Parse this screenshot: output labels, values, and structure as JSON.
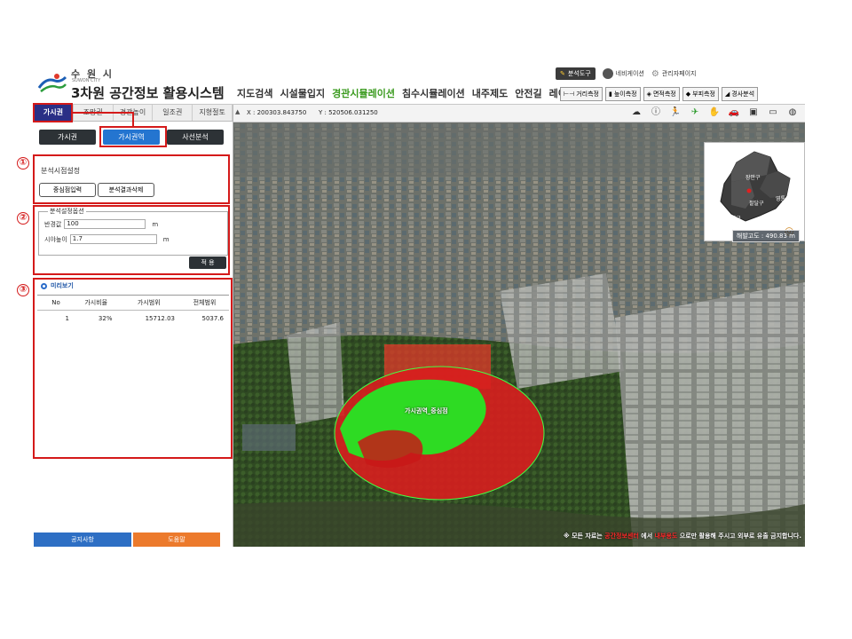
{
  "header": {
    "city_name": "수 원 시",
    "city_name_en": "SUWON CITY",
    "system_title": "3차원 공간정보 활용시스템",
    "nav": [
      "지도검색",
      "시설물입지",
      "경관시뮬레이션",
      "침수시뮬레이션",
      "내주제도",
      "안전길",
      "레이어"
    ],
    "active_nav": "경관시뮬레이션",
    "tools_top": [
      "분석도구",
      "네비게이션",
      "관리자페이지"
    ],
    "tools_measure": [
      "거리측정",
      "높이측정",
      "면적측정",
      "부피측정",
      "경사분석"
    ]
  },
  "left_panel": {
    "tabs": [
      "가시권",
      "조망권",
      "경관높이",
      "일조권",
      "지형절토"
    ],
    "active_tab": "가시권",
    "subtabs": [
      "가시권",
      "가시권역",
      "사선분석"
    ],
    "active_subtab": "가시권역",
    "analysis_point": {
      "title": "분석시점설정",
      "btn_center": "중심점입력",
      "btn_delete": "분석결과삭제"
    },
    "settings": {
      "legend": "분석설정옵션",
      "radius_label": "반경값",
      "radius_value": "100",
      "radius_unit": "m",
      "height_label": "시야높이",
      "height_value": "1.7",
      "height_unit": "m",
      "apply": "적 용"
    },
    "preview": {
      "title": "미리보기",
      "columns": [
        "No",
        "가시비율",
        "가시범위",
        "전체범위"
      ],
      "rows": [
        [
          "1",
          "32%",
          "15712.03",
          "5037.6"
        ]
      ]
    },
    "bottom": {
      "notice": "공지사항",
      "help": "도움말"
    }
  },
  "map": {
    "coord_x_label": "X : 200303.843750",
    "coord_y_label": "Y : 520506.031250",
    "altitude": "해발고도 : 490.83 m",
    "viewshed_label": "가시권역_중심점",
    "minimap_districts": [
      "장안구",
      "영통구",
      "팔달구",
      "권선구"
    ],
    "footer_prefix": "※ 모든 자료는",
    "footer_red1": "공간정보센터",
    "footer_mid": "에서",
    "footer_red2": "내부용도",
    "footer_suffix": "으로만 활용해 주시고 외부로 유출 금지합니다."
  },
  "annotations": {
    "markers": [
      "①",
      "②",
      "③"
    ]
  },
  "colors": {
    "active_tab": "#2a2f86",
    "active_subtab": "#2475d0",
    "highlight_red": "#d41a1a",
    "viewshed_green": "#22e020",
    "viewshed_red": "#e01a1a",
    "active_nav_green": "#3a9a1e"
  }
}
